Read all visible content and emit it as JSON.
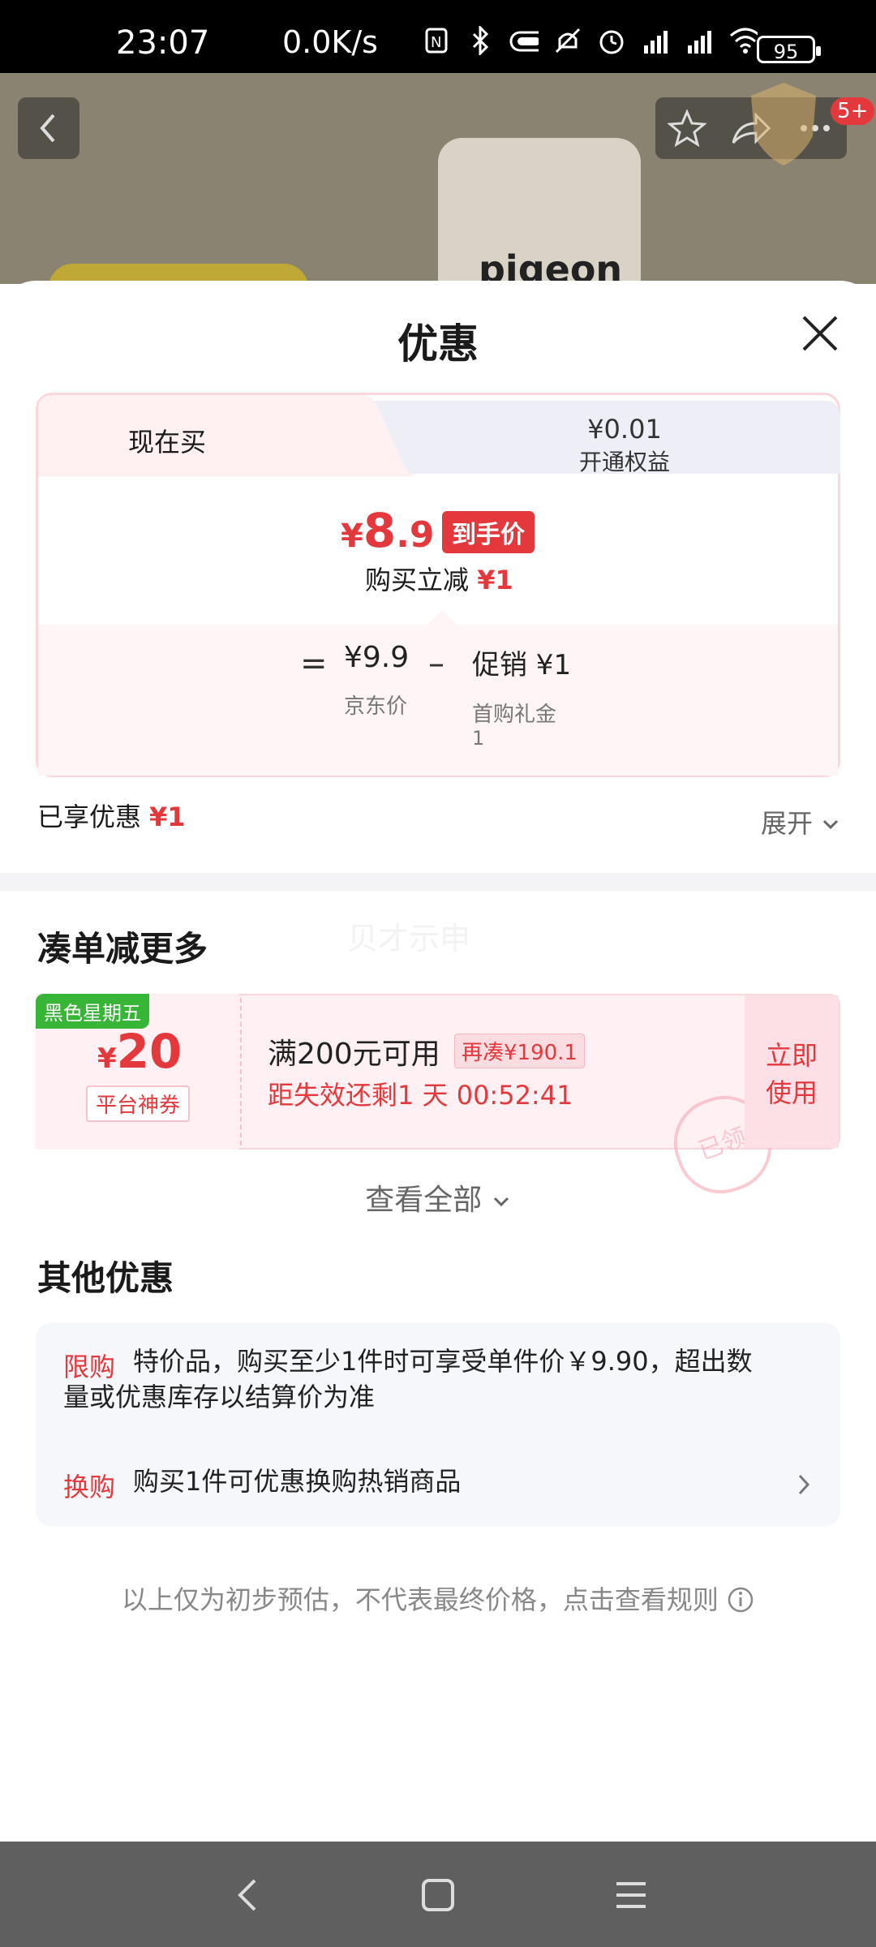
{
  "status_bar": {
    "time": "23:07",
    "net_speed": "0.0K/s",
    "battery": "95"
  },
  "background": {
    "brand": "pigeon",
    "cart_badge": "5+"
  },
  "sheet": {
    "title": "优惠",
    "tabs": [
      {
        "label": "现在买"
      },
      {
        "price": "¥0.01",
        "label": "开通权益"
      }
    ],
    "final_price": {
      "currency": "¥",
      "integer": "8",
      "decimal": ".9",
      "tag": "到手价"
    },
    "instant_discount": {
      "label": "购买立减",
      "amount": "¥1"
    },
    "breakdown": {
      "equals": "=",
      "jd_price": "¥9.9",
      "jd_label": "京东价",
      "minus": "–",
      "promo": "促销 ¥1",
      "promo_sub": "首购礼金",
      "promo_sub_count": "1"
    },
    "enjoyed": {
      "label": "已享优惠",
      "amount": "¥1"
    },
    "expand_label": "展开"
  },
  "bundle": {
    "title": "凑单减更多",
    "faint_text": "贝才示申",
    "coupon": {
      "tag": "黑色星期五",
      "currency": "¥",
      "amount": "20",
      "type": "平台神券",
      "condition": "满200元可用",
      "extra": "再凑¥190.1",
      "countdown": "距失效还剩1 天 00:52:41",
      "cta_line1": "立即",
      "cta_line2": "使用",
      "stamp": "已领"
    },
    "view_all": "查看全部"
  },
  "others": {
    "title": "其他优惠",
    "items": [
      {
        "label": "限购",
        "text": "特价品，购买至少1件时可享受单件价￥9.90，超出数量或优惠库存以结算价为准"
      },
      {
        "label": "换购",
        "text": "购买1件可优惠换购热销商品"
      }
    ]
  },
  "disclaimer": "以上仅为初步预估，不代表最终价格，点击查看规则",
  "colors": {
    "accent": "#e4393c",
    "green_tag": "#37b537",
    "pink_border": "#fbd6dc"
  }
}
